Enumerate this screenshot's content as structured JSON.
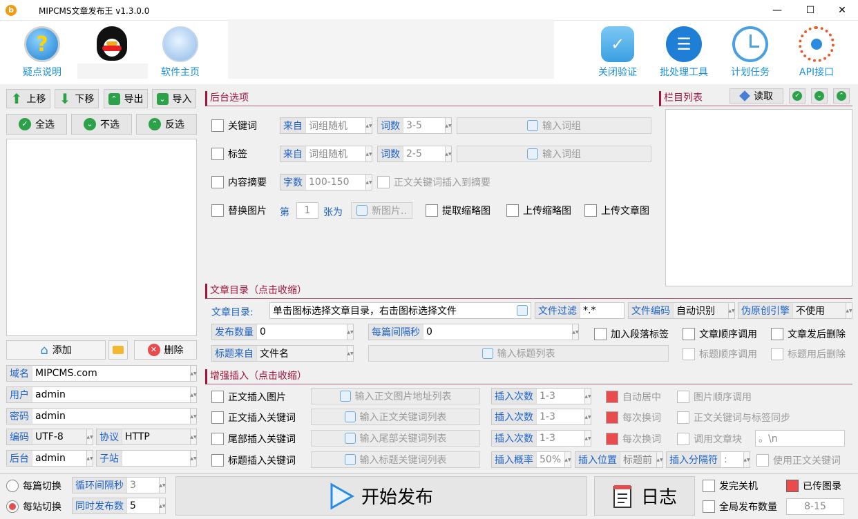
{
  "window": {
    "title": "MIPCMS文章发布王 v1.3.0.0",
    "app_icon": "b"
  },
  "toolbar": {
    "help": "疑点说明",
    "homepage": "软件主页",
    "close_verify": "关闭验证",
    "batch_tool": "批处理工具",
    "schedule": "计划任务",
    "api": "API接口"
  },
  "left": {
    "up": "上移",
    "down": "下移",
    "export": "导出",
    "import": "导入",
    "select_all": "全选",
    "select_none": "不选",
    "invert": "反选",
    "add": "添加",
    "delete": "删除",
    "domain_label": "域名",
    "domain": "MIPCMS.com",
    "user_label": "用户",
    "user": "admin",
    "password_label": "密码",
    "password": "admin",
    "encoding_label": "编码",
    "encoding": "UTF-8",
    "protocol_label": "协议",
    "protocol": "HTTP",
    "backend_label": "后台",
    "backend": "admin",
    "substation_label": "子站",
    "substation": ""
  },
  "backend": {
    "header": "后台选项",
    "keyword": "关键词",
    "tag": "标签",
    "summary": "内容摘要",
    "replace_img": "替换图片",
    "from_label": "来自",
    "from_value": "词组随机",
    "count_label": "词数",
    "keyword_count": "3-5",
    "tag_count": "2-5",
    "input_phrase": "输入词组",
    "chars_label": "字数",
    "chars": "100-150",
    "insert_kw_summary": "正文关键词插入到摘要",
    "nth": "第",
    "nth_value": "1",
    "as": "张为",
    "new_img": "新图片..",
    "extract_thumb": "提取缩略图",
    "upload_thumb": "上传缩略图",
    "upload_img": "上传文章图"
  },
  "category": {
    "header": "栏目列表",
    "read": "读取"
  },
  "article_dir": {
    "header": "文章目录（点击收缩）",
    "dir_label": "文章目录:",
    "dir_placeholder": "单击图标选择文章目录，右击图标选择文件",
    "filter_label": "文件过滤",
    "filter": "*.*",
    "enc_label": "文件编码",
    "enc": "自动识别",
    "pseudo_label": "伪原创引擎",
    "pseudo": "不使用",
    "publish_count_label": "发布数量",
    "publish_count": "0",
    "interval_label": "每篇间隔秒",
    "interval": "0",
    "add_para_tag": "加入段落标签",
    "seq_call": "文章顺序调用",
    "del_after": "文章发后删除",
    "title_src_label": "标题来自",
    "title_src": "文件名",
    "input_titles": "输入标题列表",
    "title_seq": "标题顺序调用",
    "title_del": "标题用后删除"
  },
  "enhance": {
    "header": "增强插入（点击收缩）",
    "row1": "正文插入图片",
    "row1_btn": "输入正文图片地址列表",
    "row2": "正文插入关键词",
    "row2_btn": "输入正文关键词列表",
    "row3": "尾部插入关键词",
    "row3_btn": "输入尾部关键词列表",
    "row4": "标题插入关键词",
    "row4_btn": "输入标题关键词列表",
    "times_label": "插入次数",
    "times": "1-3",
    "prob_label": "插入概率",
    "prob": "50%",
    "pos_label": "插入位置",
    "pos": "标题前",
    "sep_label": "插入分隔符",
    "sep": ":",
    "auto_center": "自动居中",
    "img_seq": "图片顺序调用",
    "each_change1": "每次换词",
    "kw_tag_sync": "正文关键词与标签同步",
    "each_change2": "每次换词",
    "call_block": "调用文章块",
    "block_value": "。\\n",
    "use_body_kw": "使用正文关键词"
  },
  "bottom": {
    "per_article": "每篇切换",
    "per_site": "每站切换",
    "loop_label": "循环间隔秒",
    "loop": "3",
    "concurrent_label": "同时发布数",
    "concurrent": "5",
    "start": "开始发布",
    "log": "日志",
    "shutdown": "发完关机",
    "uploaded_img": "已传图录",
    "global_count": "全局发布数量",
    "global_value": "8-15"
  },
  "colors": {
    "accent": "#a0143c",
    "link": "#1d63c8",
    "green": "#2da14a",
    "red": "#e84c4c"
  }
}
